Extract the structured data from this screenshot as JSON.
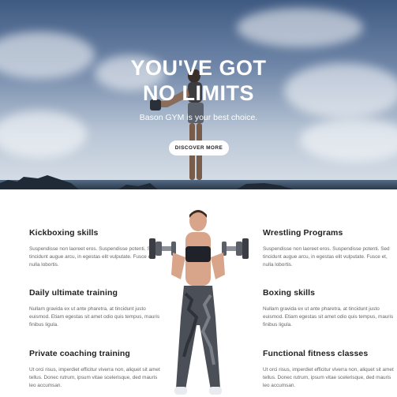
{
  "hero": {
    "title_line1": "YOU'VE GOT",
    "title_line2": "NO LIMITS",
    "subtitle": "Bason GYM is your best choice.",
    "button_label": "DISCOVER MORE"
  },
  "features": {
    "left": [
      {
        "title": "Kickboxing skills",
        "text": "Suspendisse non laoreet eros. Suspendisse potenti. Sed tincidunt augue arcu, in egestas elit vulputate. Fusce et, nulla lobortis."
      },
      {
        "title": "Daily ultimate training",
        "text": "Nullam gravida ex ut ante pharetra, at tincidunt justo euismod. Etiam egestas sit amet odio quis tempus, mauris finibus ligula."
      },
      {
        "title": "Private coaching training",
        "text": "Ut orci risus, imperdiet efficitur viverra non, aliquet sit amet tellus. Donec rutrum, ipsum vitae scelerisque, ded mauris leo accumsan."
      }
    ],
    "right": [
      {
        "title": "Wrestling Programs",
        "text": "Suspendisse non laoreet eros. Suspendisse potenti. Sed tincidunt augue arcu, in egestas elit vulputate. Fusce et, nulla lobortis."
      },
      {
        "title": "Boxing skills",
        "text": "Nullam gravida ex ut ante pharetra, at tincidunt justo euismod. Etiam egestas sit amet odio quis tempus, mauris finibus ligula."
      },
      {
        "title": "Functional fitness classes",
        "text": "Ut orci risus, imperdiet efficitur viverra non, aliquet sit amet tellus. Donec rutrum, ipsum vitae scelerisque, ded mauris leo accumsan."
      }
    ]
  }
}
